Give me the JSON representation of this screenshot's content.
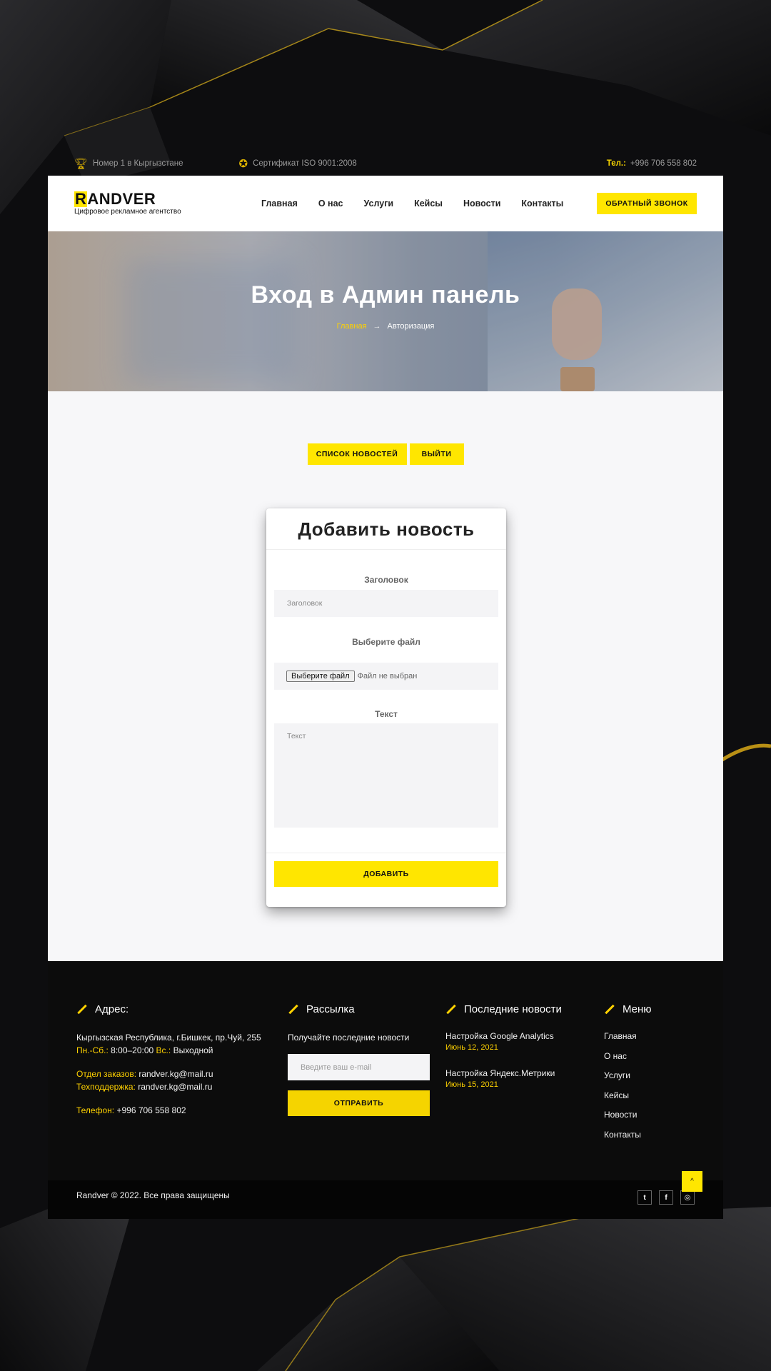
{
  "topbar": {
    "rank": "Номер 1 в Кыргызстане",
    "cert": "Сертификат ISO 9001:2008",
    "phone_label": "Тел.:",
    "phone": "+996 706 558 802"
  },
  "header": {
    "logo_r": "R",
    "logo_rest": "ANDVER",
    "logo_sub": "Цифровое рекламное агентство",
    "nav": [
      "Главная",
      "О нас",
      "Услуги",
      "Кейсы",
      "Новости",
      "Контакты"
    ],
    "callback": "ОБРАТНЫЙ ЗВОНОК"
  },
  "hero": {
    "title": "Вход в Админ панель",
    "crumb_home": "Главная",
    "crumb_arrow": "→",
    "crumb_current": "Авторизация"
  },
  "actions": {
    "list": "СПИСОК НОВОСТЕЙ",
    "exit": "ВЫЙТИ"
  },
  "form": {
    "title": "Добавить новость",
    "title_label": "Заголовок",
    "title_placeholder": "Заголовок",
    "file_label": "Выберите файл",
    "file_button": "Выберите файл",
    "file_status": "Файл не выбран",
    "text_label": "Текст",
    "text_placeholder": "Текст",
    "submit": "ДОБАВИТЬ"
  },
  "footer": {
    "address": {
      "heading": "Адрес:",
      "line": "Кыргызская Республика, г.Бишкек, пр.Чуй, 255",
      "hours_label1": "Пн.-Сб.:",
      "hours1": "8:00–20:00",
      "hours_label2": "Вс.:",
      "hours2": "Выходной",
      "orders_label": "Отдел заказов:",
      "orders": "randver.kg@mail.ru",
      "support_label": "Техподдержка:",
      "support": "randver.kg@mail.ru",
      "phone_label": "Телефон:",
      "phone": "+996 706 558 802"
    },
    "newsletter": {
      "heading": "Рассылка",
      "text": "Получайте последние новости",
      "placeholder": "Введите ваш e-mail",
      "button": "ОТПРАВИТЬ"
    },
    "news": {
      "heading": "Последние новости",
      "items": [
        {
          "title": "Настройка Google Analytics",
          "date": "Июнь 12, 2021"
        },
        {
          "title": "Настройка Яндекс.Метрики",
          "date": "Июнь 15, 2021"
        }
      ]
    },
    "menu": {
      "heading": "Меню",
      "items": [
        "Главная",
        "О нас",
        "Услуги",
        "Кейсы",
        "Новости",
        "Контакты"
      ]
    },
    "copyright": "Randver © 2022. Все права защищены",
    "socials": [
      "twitter-icon",
      "facebook-icon",
      "instagram-icon"
    ]
  },
  "colors": {
    "accent": "#ffe600",
    "dark": "#0c0c0c",
    "content_bg": "#f7f7f9"
  }
}
